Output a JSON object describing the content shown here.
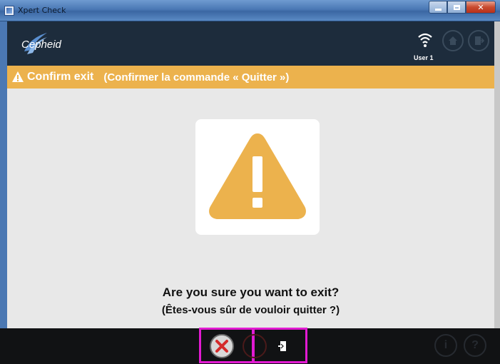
{
  "window": {
    "title": "Xpert Check"
  },
  "header": {
    "logo_text": "Cepheid",
    "user_label": "User 1",
    "icons": [
      "wifi-icon",
      "home-icon",
      "exit-icon"
    ]
  },
  "confirm_bar": {
    "title": "Confirm exit",
    "subtitle": "(Confirmer la commande « Quitter »)"
  },
  "dialog": {
    "question_en": "Are you sure you want to exit?",
    "question_fr": "(Êtes-vous sûr de vouloir quitter ?)"
  },
  "footer": {
    "info_label": "i",
    "help_label": "?"
  },
  "colors": {
    "header_bg": "#1d2c3c",
    "accent_yellow": "#ecb24d",
    "footer_bg": "#111214",
    "highlight_magenta": "#e21ad2",
    "cancel_red": "#d42a2a"
  }
}
